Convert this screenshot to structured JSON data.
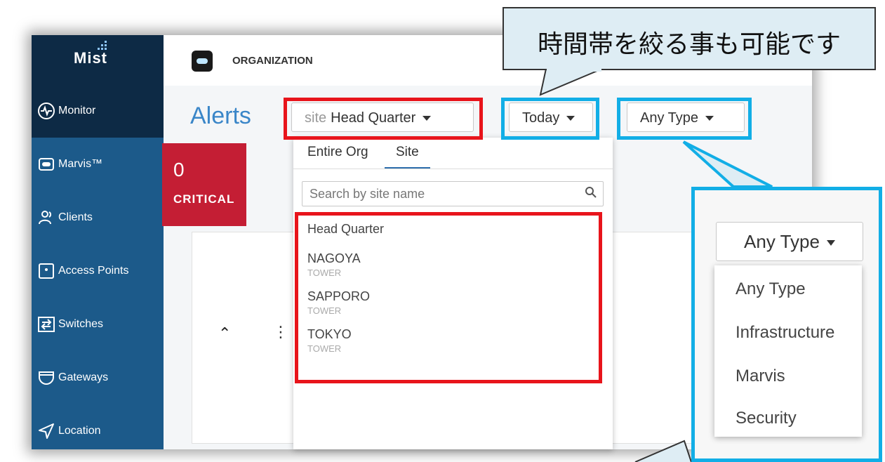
{
  "sidebar": {
    "logo": "Mist",
    "items": [
      {
        "label": "Monitor",
        "icon": "pulse-icon"
      },
      {
        "label": "Marvis™",
        "icon": "marvis-icon"
      },
      {
        "label": "Clients",
        "icon": "users-icon"
      },
      {
        "label": "Access Points",
        "icon": "access-point-icon"
      },
      {
        "label": "Switches",
        "icon": "switch-icon"
      },
      {
        "label": "Gateways",
        "icon": "gateway-icon"
      },
      {
        "label": "Location",
        "icon": "location-arrow-icon"
      }
    ]
  },
  "header": {
    "org_label": "ORGANIZATION"
  },
  "main": {
    "title": "Alerts",
    "site_filter": {
      "prefix": "site",
      "value": "Head Quarter"
    },
    "time_filter": {
      "value": "Today"
    },
    "type_filter": {
      "value": "Any Type"
    },
    "critical": {
      "count": "0",
      "label": "CRITICAL"
    }
  },
  "site_menu": {
    "tabs": [
      "Entire Org",
      "Site"
    ],
    "active_tab": "Site",
    "search_placeholder": "Search by site name",
    "sites": [
      {
        "name": "Head Quarter",
        "sub": ""
      },
      {
        "name": "NAGOYA",
        "sub": "TOWER"
      },
      {
        "name": "SAPPORO",
        "sub": "TOWER"
      },
      {
        "name": "TOKYO",
        "sub": "TOWER"
      }
    ]
  },
  "callout": {
    "text": "時間帯を絞る事も可能です"
  },
  "type_menu": {
    "selected": "Any Type",
    "options": [
      "Any Type",
      "Infrastructure",
      "Marvis",
      "Security"
    ]
  },
  "colors": {
    "highlight_red": "#e8141b",
    "highlight_blue": "#12aee6",
    "critical": "#c41e34",
    "sidebar": "#1c5a8a"
  }
}
